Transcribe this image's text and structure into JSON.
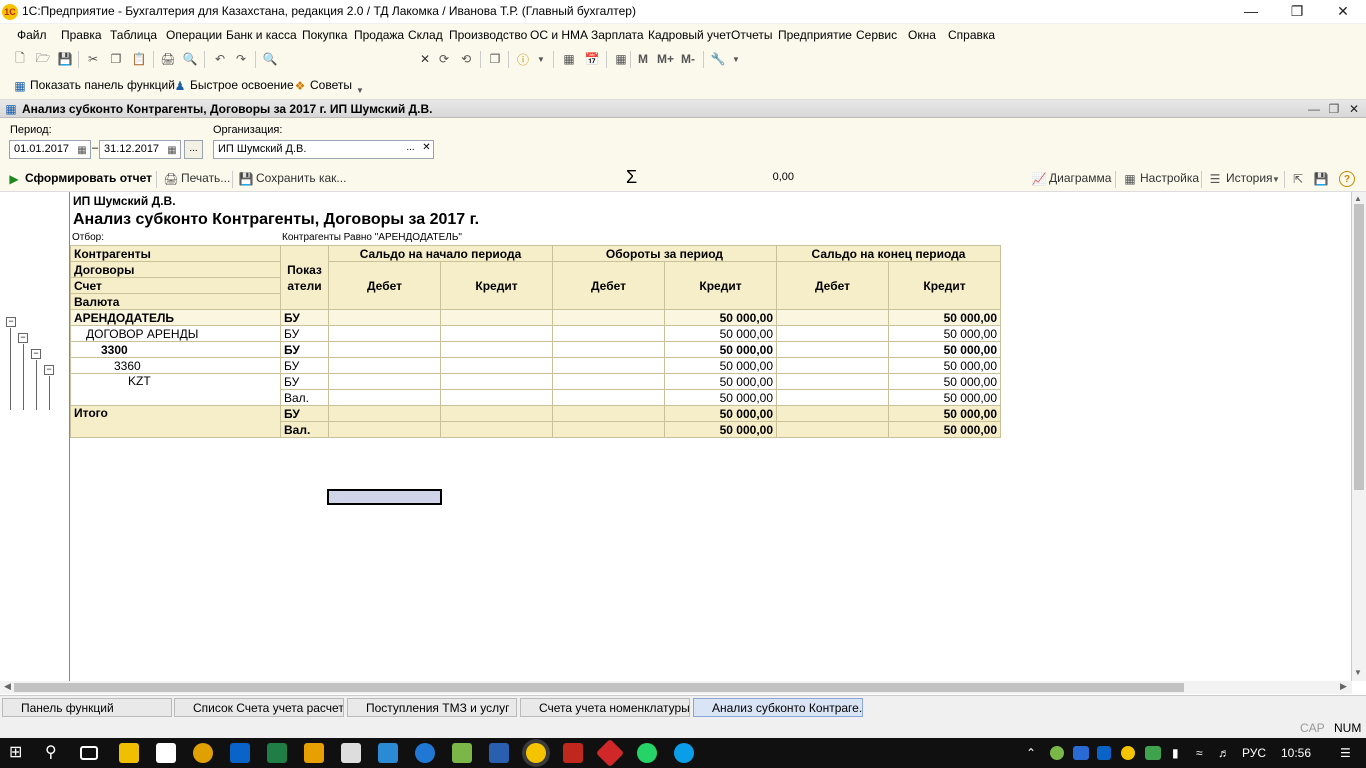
{
  "window": {
    "title": "1С:Предприятие - Бухгалтерия для Казахстана, редакция 2.0 / ТД Лакомка / Иванова Т.Р. (Главный бухгалтер)",
    "logo_text": "1С"
  },
  "menu": [
    "Файл",
    "Правка",
    "Таблица",
    "Операции",
    "Банк и касса",
    "Покупка",
    "Продажа",
    "Склад",
    "Производство",
    "ОС и НМА",
    "Зарплата",
    "Кадровый учет",
    "Отчеты",
    "Предприятие",
    "Сервис",
    "Окна",
    "Справка"
  ],
  "toolbar1": {
    "m": "M",
    "mplus": "M+",
    "mminus": "M-"
  },
  "toolbar2": {
    "show_panel": "Показать панель функций",
    "quick_learn": "Быстрое освоение",
    "tips": "Советы"
  },
  "document": {
    "title": "Анализ субконто Контрагенты, Договоры за 2017 г. ИП Шумский Д.В.",
    "period_label": "Период:",
    "date_from": "01.01.2017",
    "date_to": "31.12.2017",
    "dash": "–",
    "org_label": "Организация:",
    "org_value": "ИП Шумский Д.В.",
    "ellipsis": "...",
    "clear": "✕"
  },
  "commands": {
    "generate": "Сформировать отчет",
    "print": "Печать...",
    "save": "Сохранить как...",
    "sigma": "Σ",
    "sum": "0,00",
    "chart": "Диаграмма",
    "settings": "Настройка",
    "history": "История"
  },
  "report": {
    "org": "ИП Шумский Д.В.",
    "title": "Анализ субконто Контрагенты, Договоры за 2017 г.",
    "filter_label": "Отбор:",
    "filter_value": "Контрагенты Равно \"АРЕНДОДАТЕЛЬ\"",
    "headers": {
      "h1": "Контрагенты",
      "h2": "Договоры",
      "h3": "Счет",
      "h4": "Валюта",
      "indicators": "Показ атели",
      "open_balance": "Сальдо на начало периода",
      "turnover": "Обороты за период",
      "close_balance": "Сальдо на конец периода",
      "debit": "Дебет",
      "credit": "Кредит"
    },
    "rows": [
      {
        "name": "АРЕНДОДАТЕЛЬ",
        "ind": "БУ",
        "tcr": "50 000,00",
        "ccr": "50 000,00"
      },
      {
        "name": "ДОГОВОР АРЕНДЫ",
        "ind": "БУ",
        "tcr": "50 000,00",
        "ccr": "50 000,00"
      },
      {
        "name": "3300",
        "ind": "БУ",
        "tcr": "50 000,00",
        "ccr": "50 000,00"
      },
      {
        "name": "3360",
        "ind": "БУ",
        "tcr": "50 000,00",
        "ccr": "50 000,00"
      },
      {
        "name": "KZT",
        "ind": "БУ",
        "tcr": "50 000,00",
        "ccr": "50 000,00"
      },
      {
        "name": "",
        "ind": "Вал.",
        "tcr": "50 000,00",
        "ccr": "50 000,00"
      }
    ],
    "total": {
      "label": "Итого",
      "ind1": "БУ",
      "tcr1": "50 000,00",
      "ccr1": "50 000,00",
      "ind2": "Вал.",
      "tcr2": "50 000,00",
      "ccr2": "50 000,00"
    }
  },
  "tabs": [
    "Панель функций",
    "Список Счета учета расчет...",
    "Поступления ТМЗ и услуг",
    "Счета учета номенклатуры",
    "Анализ субконто Контраге..."
  ],
  "status": {
    "cap": "CAP",
    "num": "NUM"
  },
  "tray": {
    "lang": "РУС",
    "time": "10:56"
  }
}
